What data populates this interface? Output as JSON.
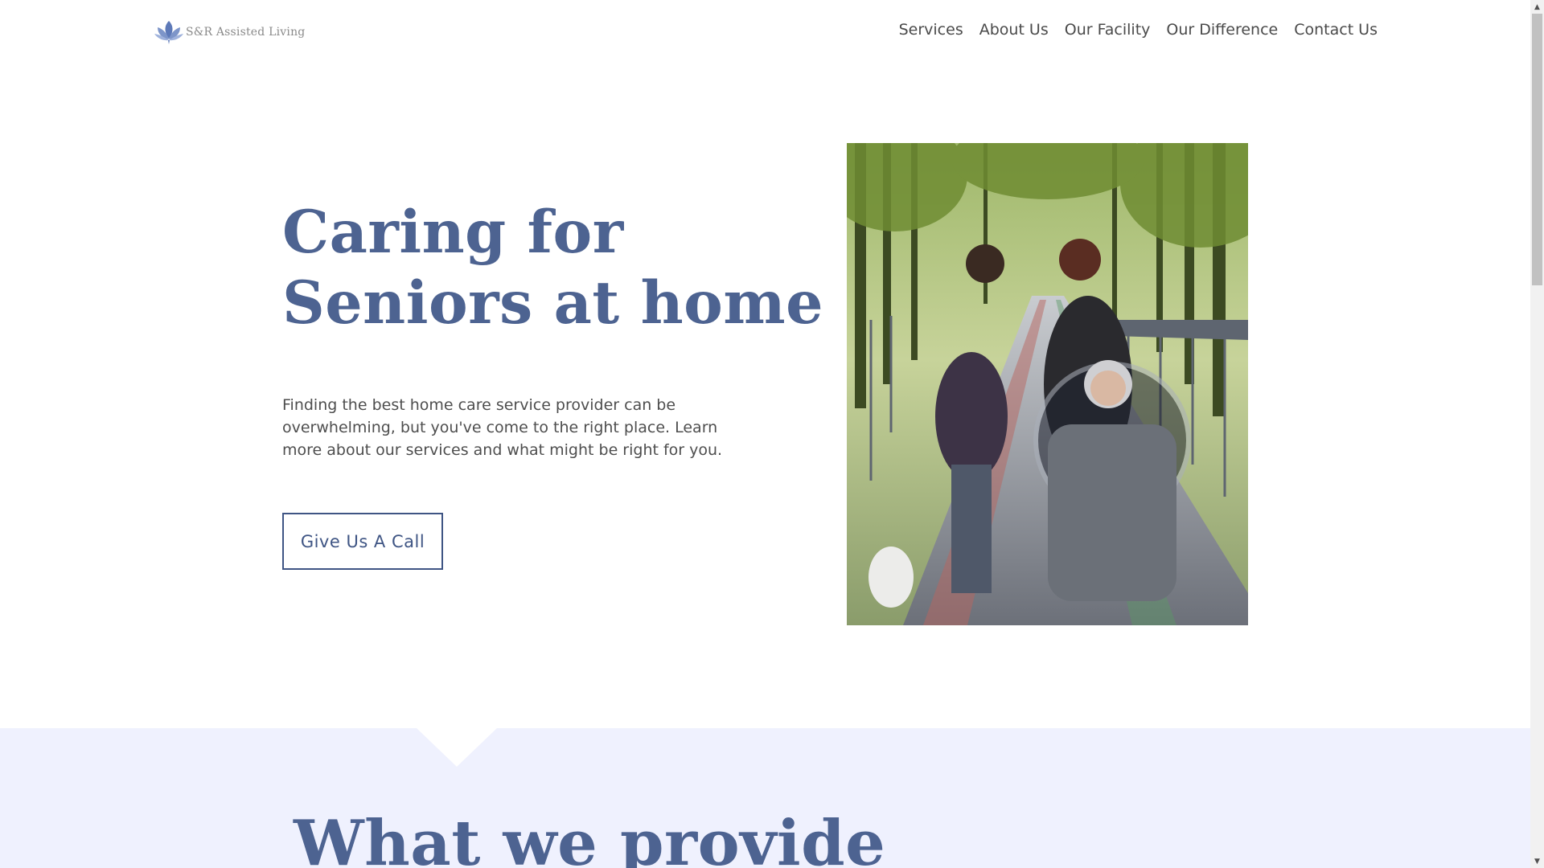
{
  "header": {
    "logo_text": "S&R Assisted Living",
    "logo_icon": "lotus-icon",
    "nav": [
      {
        "label": "Services"
      },
      {
        "label": "About Us"
      },
      {
        "label": "Our Facility"
      },
      {
        "label": "Our Difference"
      },
      {
        "label": "Contact Us"
      }
    ]
  },
  "hero": {
    "title": "Caring for\nSeniors at home",
    "description": "Finding the best home care service provider can be overwhelming, but you've come to the right place. Learn more about our services and what might be right for you.",
    "cta_label": "Give Us A Call"
  },
  "provide": {
    "title": "What we provide"
  },
  "colors": {
    "brand": "#4d6391",
    "button_border": "#3f5584",
    "section_bg": "#eff1fe",
    "nav_text": "#4a4a4a"
  },
  "scrollbar": {
    "up_icon": "scroll-up-arrow-icon",
    "down_icon": "scroll-down-arrow-icon"
  }
}
